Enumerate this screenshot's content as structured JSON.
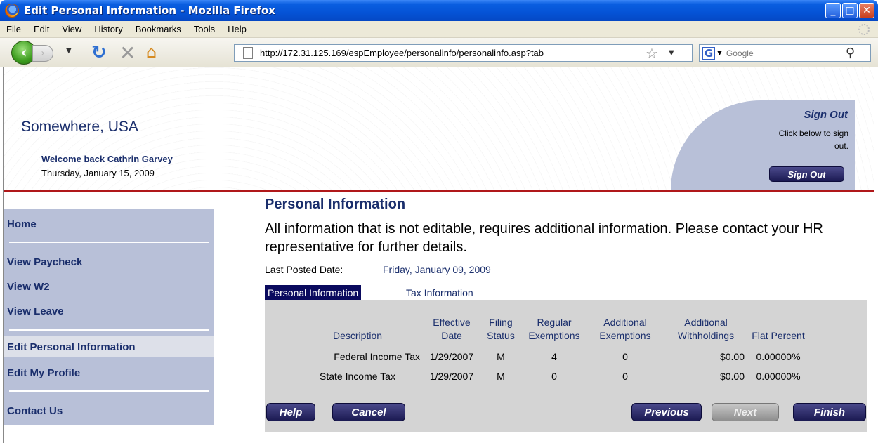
{
  "window": {
    "title": "Edit Personal Information - Mozilla Firefox",
    "controls": {
      "minimize": "_",
      "maximize": "□",
      "close": "✕"
    }
  },
  "menu": [
    "File",
    "Edit",
    "View",
    "History",
    "Bookmarks",
    "Tools",
    "Help"
  ],
  "navbar": {
    "url": "http://172.31.125.169/espEmployee/personalinfo/personalinfo.asp?tab",
    "search_placeholder": "Google"
  },
  "header": {
    "org_name": "Somewhere, USA",
    "welcome": "Welcome back Cathrin Garvey",
    "date": "Thursday, January 15, 2009",
    "sign_out_title": "Sign Out",
    "sign_out_note": "Click below to sign out.",
    "sign_out_button": "Sign Out"
  },
  "sidebar": {
    "items": [
      {
        "label": "Home"
      },
      {
        "label": "View Paycheck"
      },
      {
        "label": "View W2"
      },
      {
        "label": "View Leave"
      },
      {
        "label": "Edit Personal Information",
        "active": true
      },
      {
        "label": "Edit My Profile"
      },
      {
        "label": "Contact Us"
      }
    ]
  },
  "main": {
    "title": "Personal Information",
    "notice": "All information that is not editable, requires additional information. Please contact your HR representative for further details.",
    "last_posted_label": "Last Posted Date:",
    "last_posted_value": "Friday, January 09, 2009",
    "tabs": [
      {
        "label": "Personal Information",
        "active": true
      },
      {
        "label": "Tax Information",
        "active": false
      }
    ],
    "table": {
      "headers": [
        "Description",
        "Effective Date",
        "Filing Status",
        "Regular Exemptions",
        "Additional Exemptions",
        "Additional Withholdings",
        "Flat Percent"
      ],
      "rows": [
        [
          "Federal Income Tax",
          "1/29/2007",
          "M",
          "4",
          "0",
          "$0.00",
          "0.00000%"
        ],
        [
          "State Income Tax",
          "1/29/2007",
          "M",
          "0",
          "0",
          "$0.00",
          "0.00000%"
        ]
      ]
    },
    "buttons": {
      "help": "Help",
      "cancel": "Cancel",
      "previous": "Previous",
      "next": "Next",
      "finish": "Finish"
    }
  },
  "colors": {
    "brand_navy": "#1a2e6c",
    "panel": "#b8c0d8",
    "rule": "#b0181a"
  }
}
